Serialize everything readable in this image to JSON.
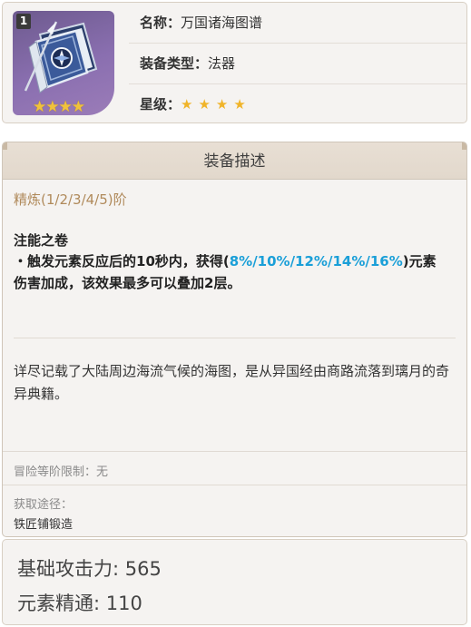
{
  "weapon": {
    "refinement_badge": "1",
    "icon": "catalyst-book-icon",
    "icon_stars": "★★★★",
    "name_label": "名称：",
    "name": "万国诸海图谱",
    "type_label": "装备类型：",
    "type": "法器",
    "rarity_label": "星级：",
    "rarity_stars": "★★★★",
    "rarity": 4
  },
  "description": {
    "header": "装备描述",
    "refine_label": "精炼(1/2/3/4/5)阶",
    "passive_name": "注能之卷",
    "passive_prefix": "・触发元素反应后的10秒内，获得(",
    "passive_highlight": "8%/10%/12%/14%/16%",
    "passive_suffix": ")元素伤害加成，该效果最多可以叠加2层。",
    "lore": "详尽记载了大陆周边海流气候的海图，是从异国经由商路流落到璃月的奇异典籍。",
    "limit": "冒险等阶限制：无",
    "source_label": "获取途径：",
    "source_value": "铁匠铺锻造"
  },
  "stats": {
    "atk": "基础攻击力: 565",
    "em": "元素精通: 110"
  },
  "colors": {
    "highlight": "#1a9fd8",
    "refine_label": "#b08a5b",
    "star": "#f0b429",
    "icon_bg": "#8a6fb0"
  }
}
